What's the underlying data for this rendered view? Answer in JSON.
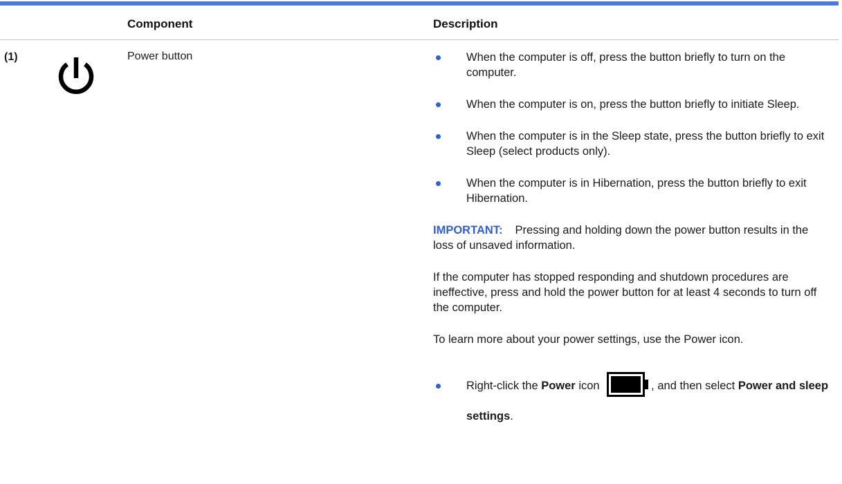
{
  "header": {
    "component_label": "Component",
    "description_label": "Description"
  },
  "row": {
    "number": "(1)",
    "icon": "power-icon",
    "component_name": "Power button",
    "bullets": [
      "When the computer is off, press the button briefly to turn on the computer.",
      "When the computer is on, press the button briefly to initiate Sleep.",
      "When the computer is in the Sleep state, press the button briefly to exit Sleep (select products only).",
      "When the computer is in Hibernation, press the button briefly to exit Hibernation."
    ],
    "important_label": "IMPORTANT:",
    "important_text": "Pressing and holding down the power button results in the loss of unsaved information.",
    "stopped_text": "If the computer has stopped responding and shutdown procedures are ineffective, press and hold the power button for at least 4 seconds to turn off the computer.",
    "learn_more_text": "To learn more about your power settings, use the Power icon.",
    "instruction": {
      "part1": "Right-click the ",
      "power_bold": "Power",
      "part2": " icon ",
      "icon": "battery-icon",
      "part3": ", and then select ",
      "setting_bold": "Power and sleep settings",
      "part4": "."
    }
  },
  "colors": {
    "accent": "#2f5fd6",
    "top_rule": "#4b79e3",
    "divider": "#bfc3c9"
  }
}
